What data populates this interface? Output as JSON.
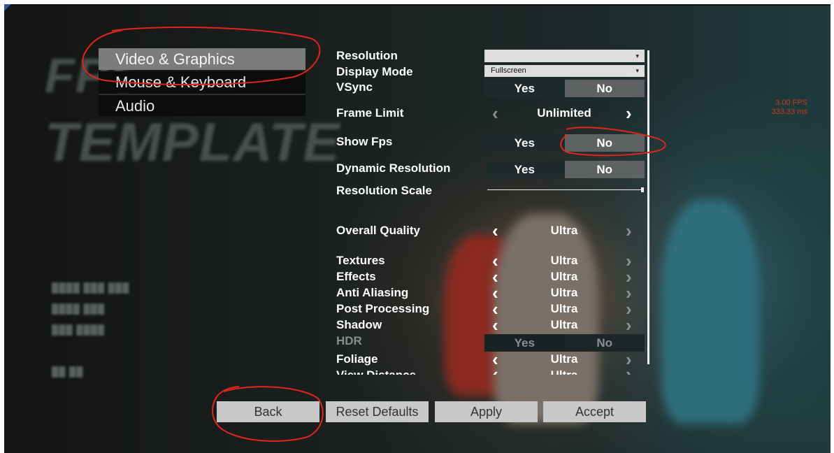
{
  "categories": [
    {
      "label": "Video & Graphics"
    },
    {
      "label": "Mouse & Keyboard"
    },
    {
      "label": "Audio"
    }
  ],
  "settings": {
    "resolution": {
      "label": "Resolution",
      "value": ""
    },
    "display_mode": {
      "label": "Display Mode",
      "value": "Fullscreen"
    },
    "vsync": {
      "label": "VSync",
      "yes": "Yes",
      "no": "No",
      "selected": "No"
    },
    "frame_limit": {
      "label": "Frame Limit",
      "value": "Unlimited"
    },
    "show_fps": {
      "label": "Show Fps",
      "yes": "Yes",
      "no": "No",
      "selected": "No"
    },
    "dynamic_resolution": {
      "label": "Dynamic Resolution",
      "yes": "Yes",
      "no": "No",
      "selected": "No"
    },
    "resolution_scale": {
      "label": "Resolution Scale",
      "level": 1.0
    },
    "overall_quality": {
      "label": "Overall Quality",
      "value": "Ultra"
    },
    "textures": {
      "label": "Textures",
      "value": "Ultra"
    },
    "effects": {
      "label": "Effects",
      "value": "Ultra"
    },
    "anti_aliasing": {
      "label": "Anti Aliasing",
      "value": "Ultra"
    },
    "post_processing": {
      "label": "Post Processing",
      "value": "Ultra"
    },
    "shadow": {
      "label": "Shadow",
      "value": "Ultra"
    },
    "hdr": {
      "label": "HDR",
      "yes": "Yes",
      "no": "No",
      "disabled": true
    },
    "foliage": {
      "label": "Foliage",
      "value": "Ultra"
    },
    "view_distance": {
      "label": "View Distance",
      "value": "Ultra"
    }
  },
  "buttons": {
    "back": "Back",
    "reset": "Reset Defaults",
    "apply": "Apply",
    "accept": "Accept"
  },
  "fps": {
    "fps_text": "3.00 FPS",
    "ms_text": "333.33 ms"
  },
  "background": {
    "title_line1": "FPS",
    "title_line2": "TEMPLATE"
  },
  "icons": {
    "left_arrow": "chevron-left-icon",
    "right_arrow": "chevron-right-icon",
    "caret": "caret-down-icon"
  },
  "colors": {
    "annotation": "#e0261c",
    "selected_tab": "#7b7d7c",
    "fps_text": "#c43b2a"
  }
}
